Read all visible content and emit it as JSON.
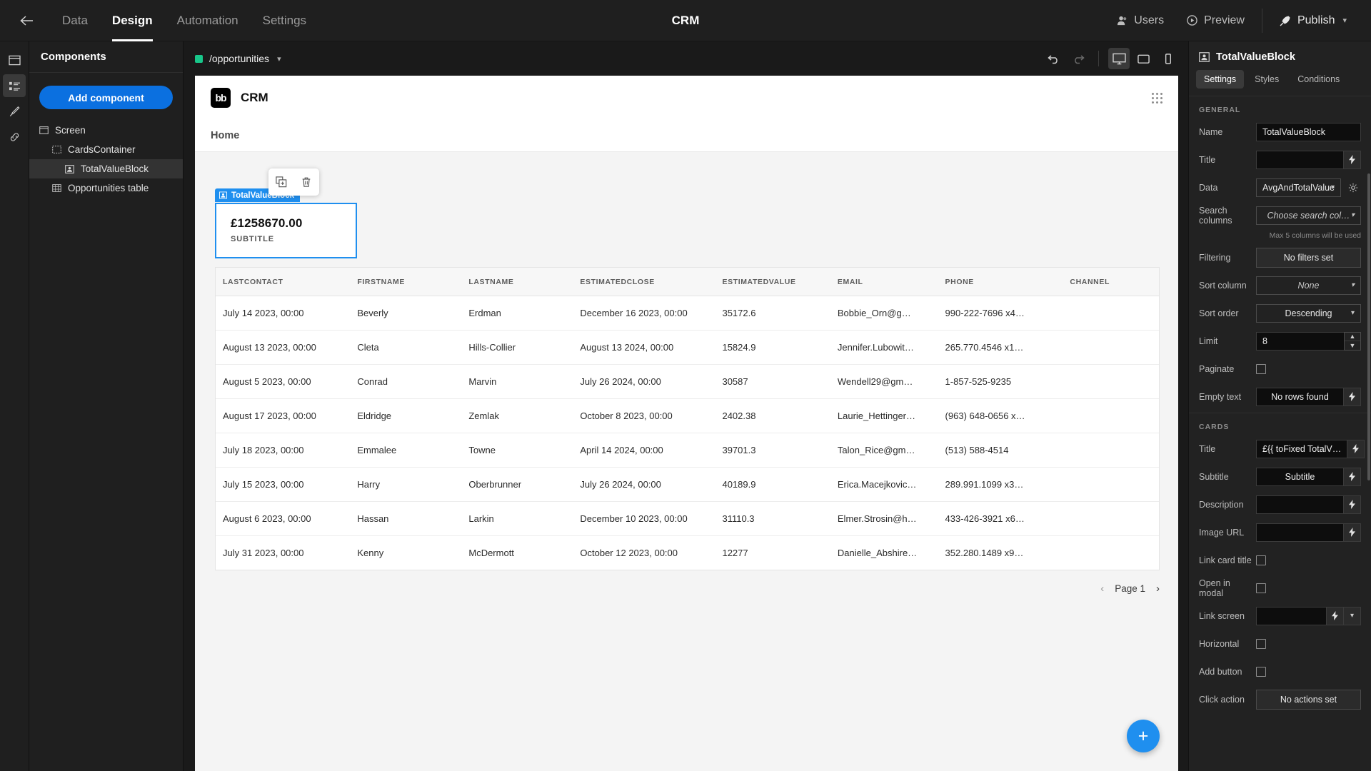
{
  "topbar": {
    "back_icon": "arrow-left-icon",
    "tabs": [
      {
        "label": "Data",
        "active": false
      },
      {
        "label": "Design",
        "active": true
      },
      {
        "label": "Automation",
        "active": false
      },
      {
        "label": "Settings",
        "active": false
      }
    ],
    "app_title": "CRM",
    "users_label": "Users",
    "preview_label": "Preview",
    "publish_label": "Publish"
  },
  "rail": {
    "items": [
      "screen-icon",
      "components-list-icon",
      "theme-brush-icon",
      "links-icon"
    ]
  },
  "components": {
    "header": "Components",
    "add_button": "Add component",
    "tree": [
      {
        "label": "Screen",
        "level": 1,
        "icon": "screen-icon",
        "selected": false
      },
      {
        "label": "CardsContainer",
        "level": 2,
        "icon": "container-icon",
        "selected": false
      },
      {
        "label": "TotalValueBlock",
        "level": 3,
        "icon": "card-block-icon",
        "selected": true
      },
      {
        "label": "Opportunities table",
        "level": 2,
        "icon": "table-icon",
        "selected": false
      }
    ]
  },
  "canvas": {
    "screen_route": "/opportunities",
    "undo_icon": "undo-icon",
    "redo_icon": "redo-icon",
    "devices": [
      {
        "name": "desktop-icon",
        "active": true
      },
      {
        "name": "tablet-icon",
        "active": false
      },
      {
        "name": "mobile-icon",
        "active": false
      }
    ]
  },
  "preview": {
    "logo_text": "bb",
    "app_name": "CRM",
    "nav_link": "Home",
    "float_tools": [
      "duplicate-icon",
      "delete-icon"
    ],
    "selection_tag": "TotalValueBlock",
    "card": {
      "value": "£1258670.00",
      "subtitle": "SUBTITLE"
    },
    "table": {
      "headers": [
        "LASTCONTACT",
        "FIRSTNAME",
        "LASTNAME",
        "ESTIMATEDCLOSE",
        "ESTIMATEDVALUE",
        "EMAIL",
        "PHONE",
        "CHANNEL"
      ],
      "rows": [
        [
          "July 14 2023, 00:00",
          "Beverly",
          "Erdman",
          "December 16 2023, 00:00",
          "35172.6",
          "Bobbie_Orn@g…",
          "990-222-7696 x4…",
          ""
        ],
        [
          "August 13 2023, 00:00",
          "Cleta",
          "Hills-Collier",
          "August 13 2024, 00:00",
          "15824.9",
          "Jennifer.Lubowit…",
          "265.770.4546 x1…",
          ""
        ],
        [
          "August 5 2023, 00:00",
          "Conrad",
          "Marvin",
          "July 26 2024, 00:00",
          "30587",
          "Wendell29@gm…",
          "1-857-525-9235",
          ""
        ],
        [
          "August 17 2023, 00:00",
          "Eldridge",
          "Zemlak",
          "October 8 2023, 00:00",
          "2402.38",
          "Laurie_Hettinger…",
          "(963) 648-0656 x…",
          ""
        ],
        [
          "July 18 2023, 00:00",
          "Emmalee",
          "Towne",
          "April 14 2024, 00:00",
          "39701.3",
          "Talon_Rice@gm…",
          "(513) 588-4514",
          ""
        ],
        [
          "July 15 2023, 00:00",
          "Harry",
          "Oberbrunner",
          "July 26 2024, 00:00",
          "40189.9",
          "Erica.Macejkovic…",
          "289.991.1099 x3…",
          ""
        ],
        [
          "August 6 2023, 00:00",
          "Hassan",
          "Larkin",
          "December 10 2023, 00:00",
          "31110.3",
          "Elmer.Strosin@h…",
          "433-426-3921 x6…",
          ""
        ],
        [
          "July 31 2023, 00:00",
          "Kenny",
          "McDermott",
          "October 12 2023, 00:00",
          "12277",
          "Danielle_Abshire…",
          "352.280.1489 x9…",
          ""
        ]
      ]
    },
    "pagination": {
      "prev": "‹",
      "page_label": "Page 1",
      "next": "›"
    },
    "fab_label": "+"
  },
  "inspector": {
    "title": "TotalValueBlock",
    "icon": "card-block-icon",
    "tabs": [
      {
        "label": "Settings",
        "active": true
      },
      {
        "label": "Styles",
        "active": false
      },
      {
        "label": "Conditions",
        "active": false
      }
    ],
    "general_label": "GENERAL",
    "name_label": "Name",
    "name_value": "TotalValueBlock",
    "title_label": "Title",
    "title_value": "",
    "data_label": "Data",
    "data_value": "AvgAndTotalValue",
    "search_columns_label": "Search columns",
    "search_columns_placeholder": "Choose search col…",
    "search_columns_hint": "Max 5 columns will be used",
    "filtering_label": "Filtering",
    "filtering_value": "No filters set",
    "sort_column_label": "Sort column",
    "sort_column_value": "None",
    "sort_order_label": "Sort order",
    "sort_order_value": "Descending",
    "limit_label": "Limit",
    "limit_value": "8",
    "paginate_label": "Paginate",
    "empty_text_label": "Empty text",
    "empty_text_value": "No rows found",
    "cards_label": "CARDS",
    "card_title_label": "Title",
    "card_title_value": "£{{ toFixed TotalV…",
    "card_subtitle_label": "Subtitle",
    "card_subtitle_value": "Subtitle",
    "card_description_label": "Description",
    "card_description_value": "",
    "card_image_url_label": "Image URL",
    "card_image_url_value": "",
    "link_card_title_label": "Link card title",
    "open_in_modal_label": "Open in modal",
    "link_screen_label": "Link screen",
    "link_screen_value": "",
    "horizontal_label": "Horizontal",
    "add_button_label": "Add button",
    "click_action_label": "Click action",
    "click_action_value": "No actions set"
  },
  "colors": {
    "accent_blue": "#0b70e0",
    "select_blue": "#1f8fef",
    "green_dot": "#18c78a"
  }
}
